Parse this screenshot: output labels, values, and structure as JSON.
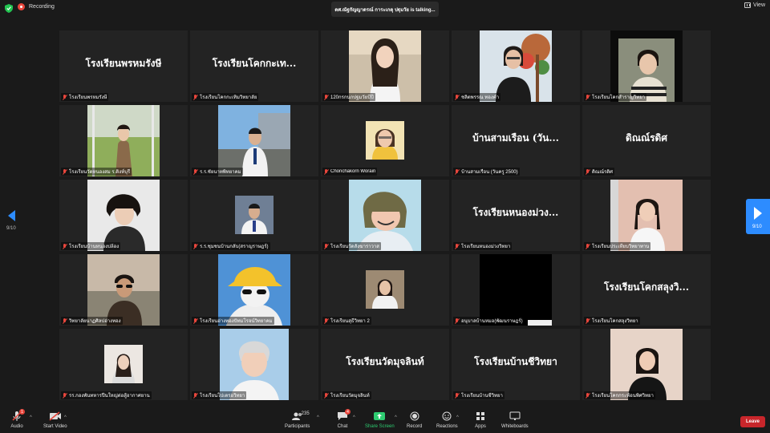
{
  "topbar": {
    "recording_label": "Recording",
    "speaker_text": "ดศ.ณัฐกัญญาดรณ์ การะเกตุ ปฐุมวัย is talking...",
    "view_label": "View"
  },
  "pagination": {
    "left": "9/10",
    "right": "9/10"
  },
  "tiles": [
    {
      "big": "โรงเรียนพรหมรังษี",
      "label": "โรงเรียนพรหมรังษี"
    },
    {
      "big": "โรงเรียนโคกกะเท...",
      "label": "โรงเรียนโคกกะเทิมวิทยาลัย"
    },
    {
      "big": "",
      "label": "120กรกนกปฐมวัยบีปี"
    },
    {
      "big": "",
      "label": "ชลิตพรรณ ทองคำ"
    },
    {
      "big": "",
      "label": "โรงเรียนโคกสำราญวิทยา"
    },
    {
      "big": "",
      "label": "โรงเรียนวัดหนองสม ร.ติงห์บุรี"
    },
    {
      "big": "",
      "label": "ร.ร.ชัยนาทพิทยาคม"
    },
    {
      "big": "",
      "label": "Chonchakorn Worain"
    },
    {
      "big": "บ้านสามเรือน (วัน...",
      "label": "บ้านสามเรือน (วันครู 2500)"
    },
    {
      "big": "ดิณณ์รดิศ",
      "label": "ดิณณ์รดิศ"
    },
    {
      "big": "",
      "label": "โรงเรียนบ้านหนองปล้อง"
    },
    {
      "big": "",
      "label": "ร.ร.ชุมชนบ้านกลับ(สราญราษฎร์)"
    },
    {
      "big": "",
      "label": "โรงเรียนวัดสังฆาราวาส"
    },
    {
      "big": "โรงเรียนหนองม่วง...",
      "label": "โรงเรียนหนองม่วงวิทยา"
    },
    {
      "big": "",
      "label": "โรงเรียนประเทียบวิทยาทาน"
    },
    {
      "big": "",
      "label": "วิทยาลัยนาฏศิลปอ่างทอง"
    },
    {
      "big": "",
      "label": "โรงเรียนอ่างทองปัทมโรจน์วิทยาคม"
    },
    {
      "big": "",
      "label": "โรงเรียนสุธีวิทยา 2"
    },
    {
      "big": "",
      "label": "อนุบาลบ้านหมอ(พัฒนราษฎร์)"
    },
    {
      "big": "โรงเรียนโคกสลุงวิ...",
      "label": "โรงเรียนโคกสลุงวิทยา"
    },
    {
      "big": "",
      "label": "รร.กองพันทหารปืนใหญ่ต่อสู้อากาศยาน"
    },
    {
      "big": "",
      "label": "โรงเรียนโปเตรอวิทยา"
    },
    {
      "big": "โรงเรียนวัดมุจลินท์",
      "label": "โรงเรียนวัดมุจลินท์"
    },
    {
      "big": "โรงเรียนบ้านชีวิทยา",
      "label": "โรงเรียนบ้านชีวิทยา"
    },
    {
      "big": "",
      "label": "โรงเรียนโคกกระท้อนพิศวิทยา"
    }
  ],
  "toolbar": {
    "audio": "Audio",
    "video": "Start Video",
    "participants": "Participants",
    "participants_count": "235",
    "chat": "Chat",
    "chat_badge": "4",
    "share": "Share Screen",
    "record": "Record",
    "reactions": "Reactions",
    "apps": "Apps",
    "whiteboards": "Whiteboards",
    "leave": "Leave",
    "audio_badge": "1"
  },
  "colors": {
    "accent": "#2d8cff",
    "leave": "#c8262b",
    "share": "#2ecc71",
    "record_dot": "#e8463c"
  }
}
